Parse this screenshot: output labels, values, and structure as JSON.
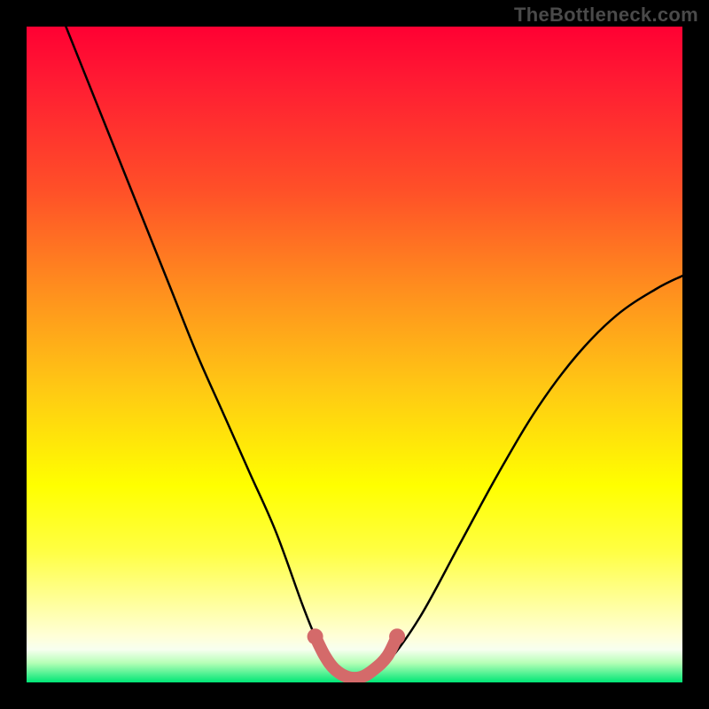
{
  "watermark": "TheBottleneck.com",
  "chart_data": {
    "type": "line",
    "title": "",
    "xlabel": "",
    "ylabel": "",
    "xlim": [
      0,
      100
    ],
    "ylim": [
      0,
      100
    ],
    "grid": false,
    "legend": false,
    "series": [
      {
        "name": "bottleneck-curve",
        "color": "#000000",
        "x": [
          6,
          10,
          14,
          18,
          22,
          26,
          30,
          34,
          38,
          42,
          44,
          46,
          49,
          52,
          55,
          60,
          66,
          72,
          78,
          84,
          90,
          96,
          100
        ],
        "values": [
          100,
          90,
          80,
          70,
          60,
          50,
          41,
          32,
          23,
          12,
          7,
          3,
          0.8,
          0.8,
          3,
          10,
          21,
          32,
          42,
          50,
          56,
          60,
          62
        ]
      },
      {
        "name": "highlight-valley",
        "color": "#d46a6a",
        "x": [
          44,
          45.5,
          47,
          49,
          51,
          53,
          55,
          56.5
        ],
        "values": [
          7,
          4,
          2,
          0.8,
          0.8,
          2,
          4,
          7
        ]
      }
    ],
    "highlight_endpoints": {
      "color": "#d46a6a",
      "points": [
        {
          "x": 44,
          "y": 7
        },
        {
          "x": 56.5,
          "y": 7
        }
      ]
    }
  }
}
